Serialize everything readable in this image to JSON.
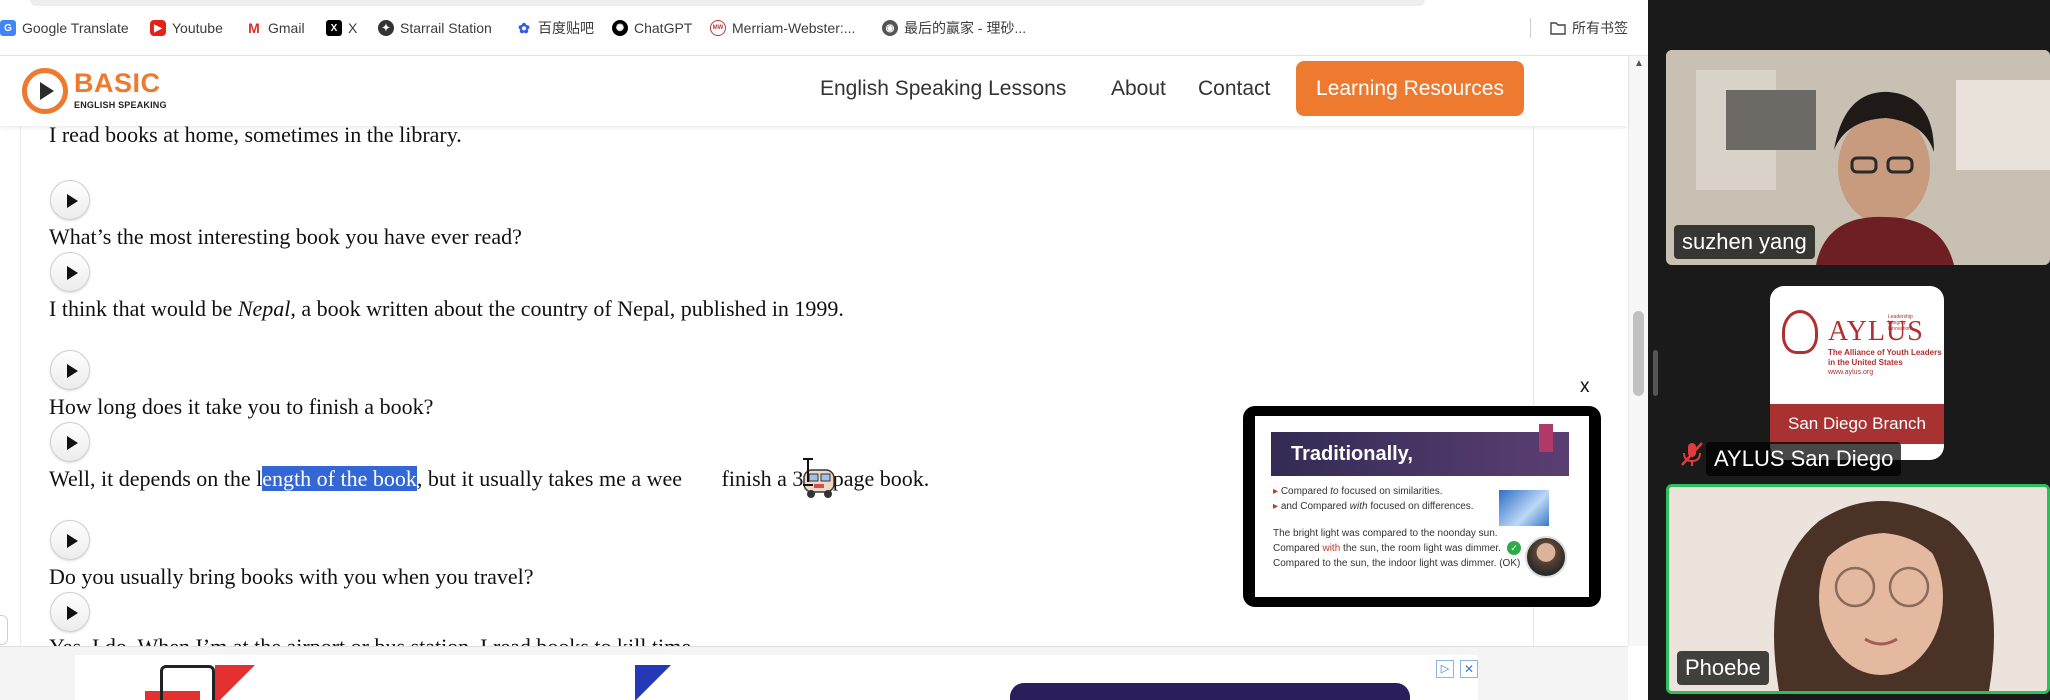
{
  "bookmarks": [
    {
      "label": "Google Translate",
      "icon": "google-translate-icon"
    },
    {
      "label": "Youtube",
      "icon": "youtube-icon"
    },
    {
      "label": "Gmail",
      "icon": "gmail-icon"
    },
    {
      "label": "X",
      "icon": "x-icon"
    },
    {
      "label": "Starrail Station",
      "icon": "starrail-icon"
    },
    {
      "label": "百度贴吧",
      "icon": "baidu-icon"
    },
    {
      "label": "ChatGPT",
      "icon": "chatgpt-icon"
    },
    {
      "label": "Merriam-Webster:...",
      "icon": "merriam-webster-icon"
    },
    {
      "label": "最后的赢家 - 理砂...",
      "icon": "bookmark-site-icon"
    }
  ],
  "all_bookmarks_label": "所有书签",
  "site": {
    "logo_word": "BASIC",
    "logo_tagline": "ENGLISH SPEAKING",
    "nav": {
      "lessons": "English Speaking Lessons",
      "about": "About",
      "contact": "Contact",
      "resources": "Learning Resources"
    },
    "accent_color": "#ee7a2f"
  },
  "content": {
    "l1": "I read books at home, sometimes in the library.",
    "l2": "What’s the most interesting book you have ever read?",
    "l3_a": "I think that would be ",
    "l3_b": "Nepal",
    "l3_c": ", a book written about the country of Nepal, published in 1999.",
    "l4": "How long does it take you to finish a book?",
    "l5_a": "Well, it depends on the l",
    "l5_hl": "ength of the book",
    "l5_b": ", but it usually takes me a wee",
    "l5_c": " finish a 300-page book.",
    "l6": "Do you usually bring books with you when you travel?",
    "l7": "Yes, I do. When I’m at the airport or bus station, I read books to kill time."
  },
  "slide": {
    "close_label": "x",
    "title": "Traditionally,",
    "bullet1_pre": "Compared ",
    "bullet1_word": "to",
    "bullet1_post": " focused on similarities.",
    "bullet2_pre": "and Compared ",
    "bullet2_word": "with",
    "bullet2_post": " focused on differences.",
    "ex1": "The bright light was compared to the noonday sun.",
    "ex2_pre": "Compared ",
    "ex2_word": "with",
    "ex2_post": " the sun, the room light was dimmer.",
    "ex3": "Compared to the sun, the indoor light was dimmer. (OK)"
  },
  "ad": {
    "info": "▷",
    "close": "✕"
  },
  "zoom": {
    "p1_name": "suzhen  yang",
    "p2_name": "AYLUS San Diego",
    "p3_name": "Phoebe",
    "aylus_word": "AYLUS",
    "aylus_tagline": "Leadership Integrity Innovation",
    "aylus_sub1": "The Alliance of Youth Leaders",
    "aylus_sub2": "in the United States",
    "aylus_url": "www.aylus.org",
    "aylus_branch": "San Diego Branch",
    "active_speaker_color": "#2fbf5a"
  }
}
